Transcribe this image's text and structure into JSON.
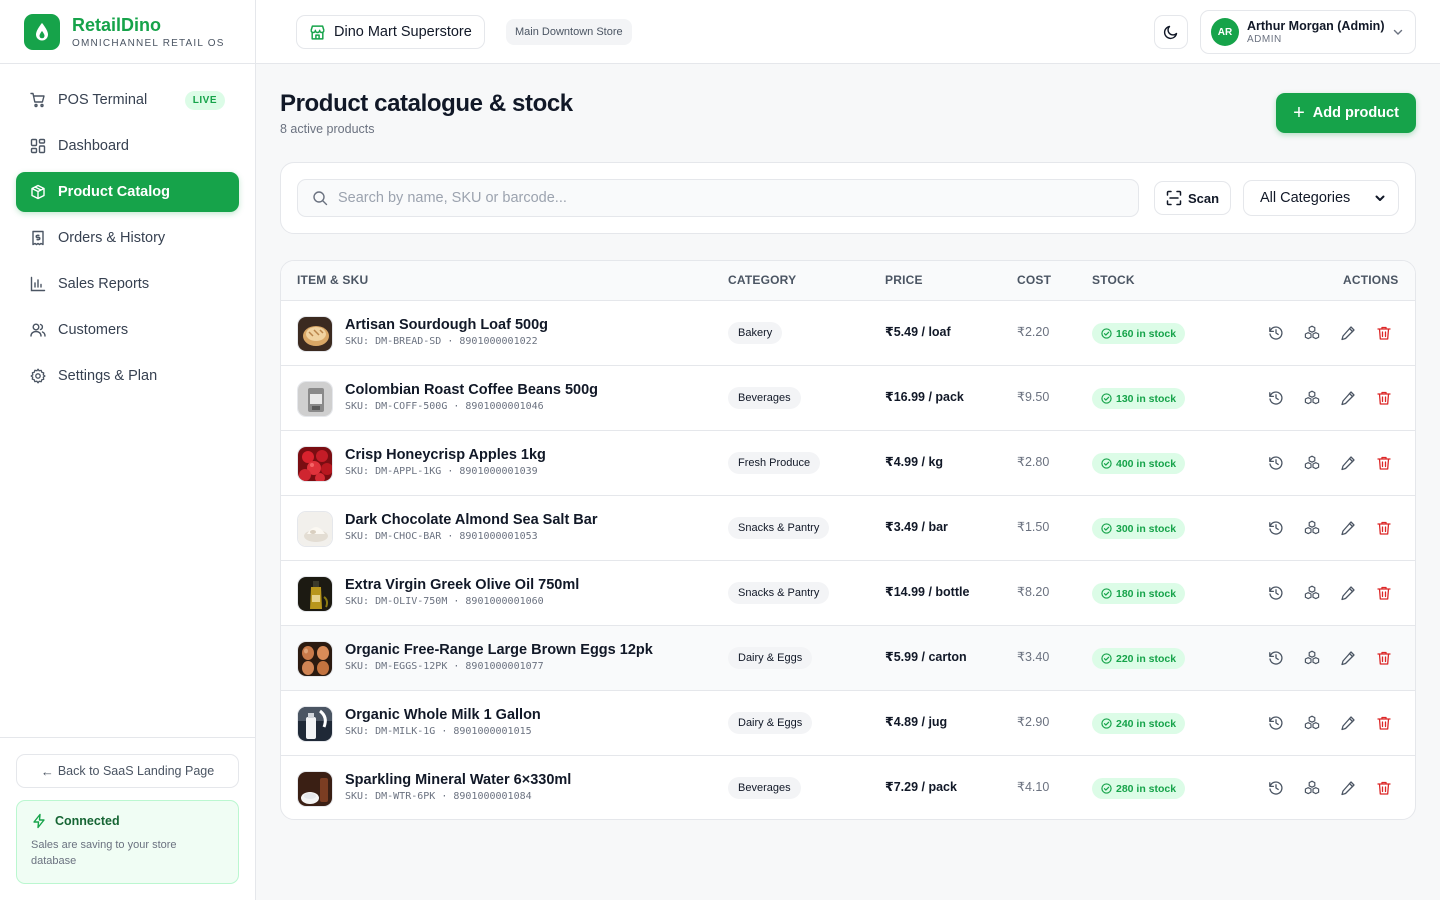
{
  "brand": {
    "name": "RetailDino",
    "tagline": "OMNICHANNEL RETAIL OS",
    "accent": "#16a34a"
  },
  "sidebar": {
    "items": [
      {
        "label": "POS Terminal",
        "icon": "cart-icon",
        "badge": "LIVE"
      },
      {
        "label": "Dashboard",
        "icon": "grid-icon"
      },
      {
        "label": "Product Catalog",
        "icon": "box-icon",
        "active": true
      },
      {
        "label": "Orders & History",
        "icon": "receipt-icon"
      },
      {
        "label": "Sales Reports",
        "icon": "bar-chart-icon"
      },
      {
        "label": "Customers",
        "icon": "users-icon"
      },
      {
        "label": "Settings & Plan",
        "icon": "gear-icon"
      }
    ],
    "back_label": "Back to SaaS Landing Page",
    "status": {
      "title": "Connected",
      "desc": "Sales are saving to your store database"
    }
  },
  "header": {
    "store": "Dino Mart Superstore",
    "branch": "Main Downtown Store",
    "user": {
      "initials": "AR",
      "name": "Arthur Morgan (Admin)",
      "role": "ADMIN"
    }
  },
  "page": {
    "title": "Product catalogue & stock",
    "subtitle": "8 active products",
    "add_label": "Add product"
  },
  "filters": {
    "search_placeholder": "Search by name, SKU or barcode...",
    "scan_label": "Scan",
    "category": "All Categories"
  },
  "table": {
    "columns": {
      "item": "ITEM & SKU",
      "category": "CATEGORY",
      "price": "PRICE",
      "cost": "COST",
      "stock": "STOCK",
      "actions": "ACTIONS"
    },
    "rows": [
      {
        "name": "Artisan Sourdough Loaf 500g",
        "sku": "SKU: DM-BREAD-SD · 8901000001022",
        "category": "Bakery",
        "price": "₹5.49 / loaf",
        "cost": "₹2.20",
        "stock": "160 in stock",
        "thumb": "bread"
      },
      {
        "name": "Colombian Roast Coffee Beans 500g",
        "sku": "SKU: DM-COFF-500G · 8901000001046",
        "category": "Beverages",
        "price": "₹16.99 / pack",
        "cost": "₹9.50",
        "stock": "130 in stock",
        "thumb": "coffee"
      },
      {
        "name": "Crisp Honeycrisp Apples 1kg",
        "sku": "SKU: DM-APPL-1KG · 8901000001039",
        "category": "Fresh Produce",
        "price": "₹4.99 / kg",
        "cost": "₹2.80",
        "stock": "400 in stock",
        "thumb": "apples"
      },
      {
        "name": "Dark Chocolate Almond Sea Salt Bar",
        "sku": "SKU: DM-CHOC-BAR · 8901000001053",
        "category": "Snacks & Pantry",
        "price": "₹3.49 / bar",
        "cost": "₹1.50",
        "stock": "300 in stock",
        "thumb": "choc"
      },
      {
        "name": "Extra Virgin Greek Olive Oil 750ml",
        "sku": "SKU: DM-OLIV-750M · 8901000001060",
        "category": "Snacks & Pantry",
        "price": "₹14.99 / bottle",
        "cost": "₹8.20",
        "stock": "180 in stock",
        "thumb": "oil"
      },
      {
        "name": "Organic Free-Range Large Brown Eggs 12pk",
        "sku": "SKU: DM-EGGS-12PK · 8901000001077",
        "category": "Dairy & Eggs",
        "price": "₹5.99 / carton",
        "cost": "₹3.40",
        "stock": "220 in stock",
        "thumb": "eggs"
      },
      {
        "name": "Organic Whole Milk 1 Gallon",
        "sku": "SKU: DM-MILK-1G · 8901000001015",
        "category": "Dairy & Eggs",
        "price": "₹4.89 / jug",
        "cost": "₹2.90",
        "stock": "240 in stock",
        "thumb": "milk"
      },
      {
        "name": "Sparkling Mineral Water 6×330ml",
        "sku": "SKU: DM-WTR-6PK · 8901000001084",
        "category": "Beverages",
        "price": "₹7.29 / pack",
        "cost": "₹4.10",
        "stock": "280 in stock",
        "thumb": "water"
      }
    ]
  }
}
